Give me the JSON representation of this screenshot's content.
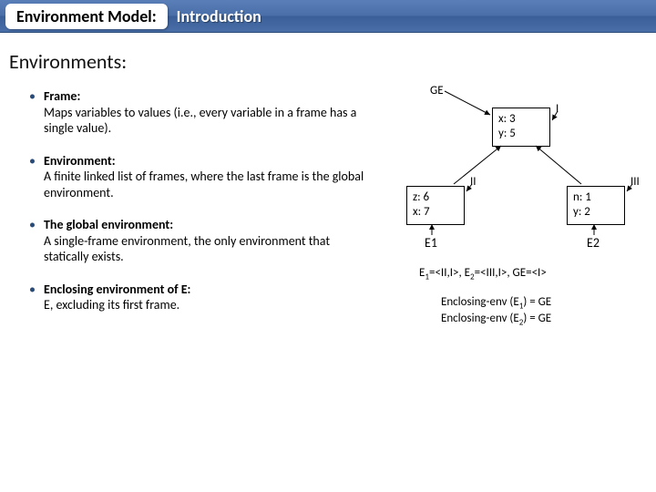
{
  "title": {
    "main": "Environment Model:",
    "sub": "Introduction"
  },
  "section_heading": "Environments:",
  "bullets": [
    {
      "title": "Frame:",
      "desc": "Maps variables to values (i.e., every variable in a frame has a single value)."
    },
    {
      "title": "Environment:",
      "desc": "A finite linked list of frames, where the last frame is the global environment."
    },
    {
      "title": "The global environment:",
      "desc": "A single-frame environment, the only environment that statically exists."
    },
    {
      "title": "Enclosing environment of E:",
      "desc": "E, excluding its first frame."
    }
  ],
  "diagram": {
    "geLabel": "GE",
    "frames": {
      "I": {
        "label": "I",
        "l1": "x: 3",
        "l2": "y: 5"
      },
      "II": {
        "label": "II",
        "l1": "z: 6",
        "l2": "x: 7"
      },
      "III": {
        "label": "III",
        "l1": "n: 1",
        "l2": "y: 2"
      }
    },
    "envs": {
      "E1": "E1",
      "E2": "E2"
    },
    "caption1a": "E",
    "caption1b": "=<II,I>, E",
    "caption1c": "=<III,I>, GE=<I>",
    "sub1": "1",
    "sub2": "2",
    "caption2a": "Enclosing-env (E",
    "caption2b": ") = GE",
    "caption3a": "Enclosing-env (E",
    "caption3b": ") = GE"
  }
}
